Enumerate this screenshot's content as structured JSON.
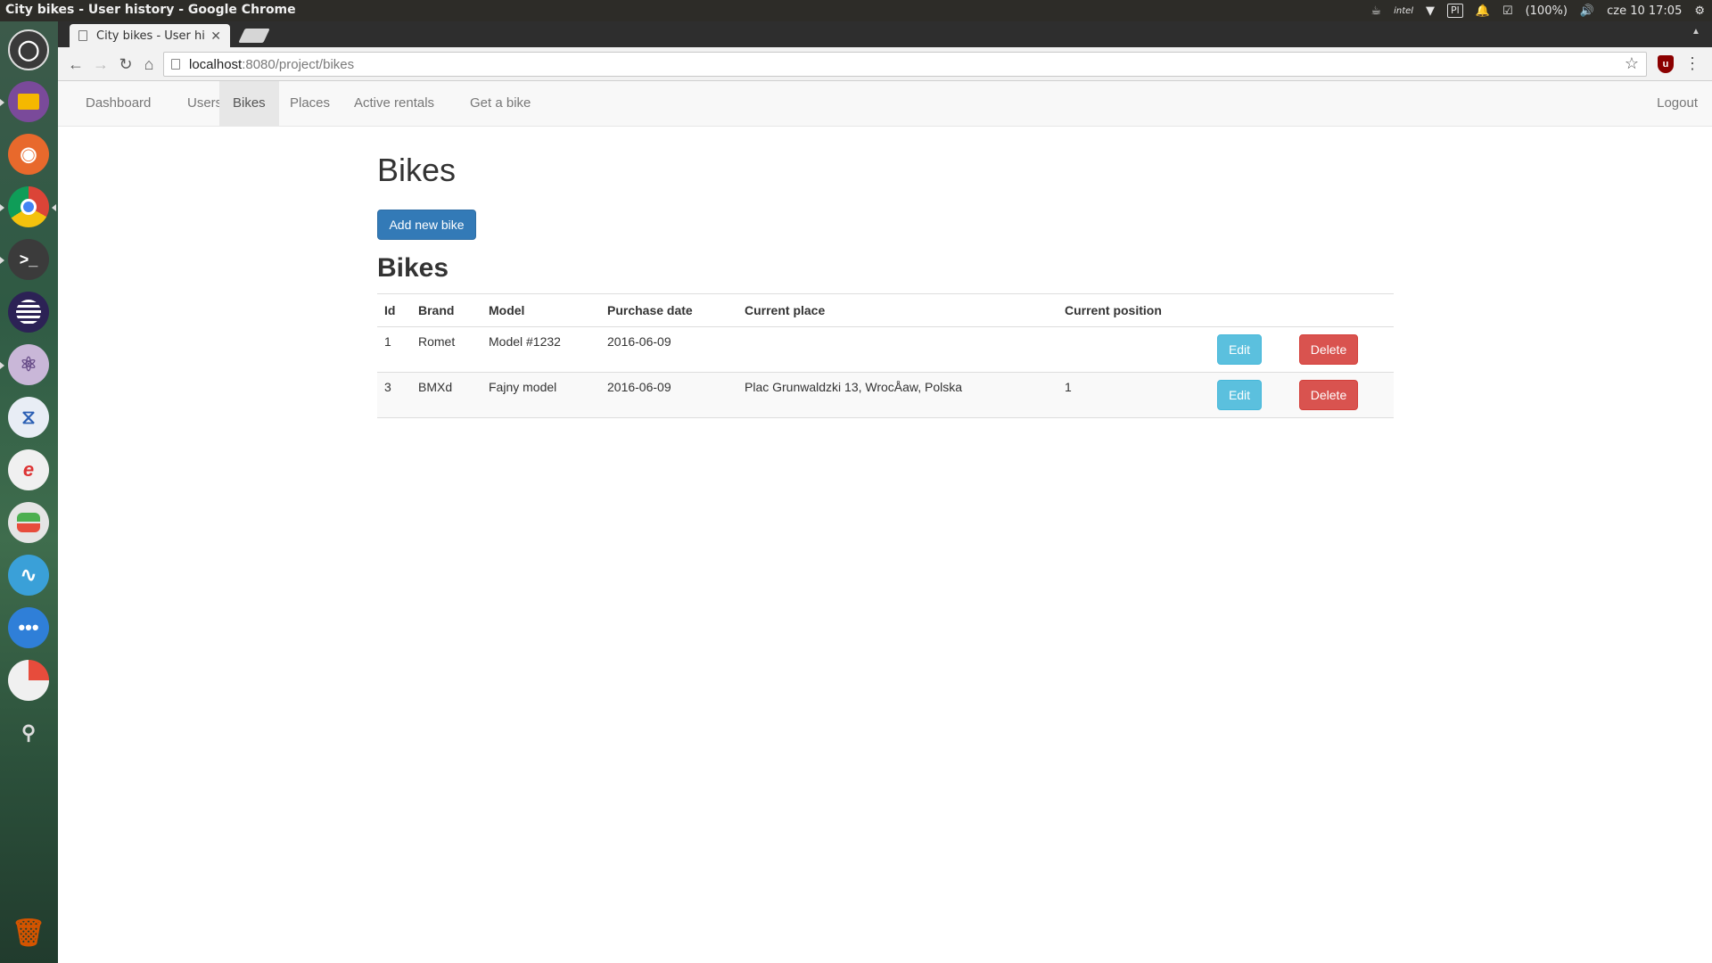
{
  "os": {
    "window_title": "City bikes - User history - Google Chrome",
    "indicators": {
      "keyboard": "Pl",
      "battery": "(100%)",
      "clock": "cze 10 17:05"
    }
  },
  "browser": {
    "tab_title": "City bikes - User his",
    "url_host": "localhost",
    "url_rest": ":8080/project/bikes"
  },
  "navbar": {
    "items": [
      {
        "label": "Dashboard"
      },
      {
        "label": "Users"
      },
      {
        "label": "Bikes",
        "active": true
      },
      {
        "label": "Places"
      },
      {
        "label": "Active rentals"
      },
      {
        "label": "Get a bike"
      }
    ],
    "logout_label": "Logout"
  },
  "page": {
    "title": "Bikes",
    "add_button": "Add new bike",
    "table_heading": "Bikes"
  },
  "table": {
    "columns": [
      "Id",
      "Brand",
      "Model",
      "Purchase date",
      "Current place",
      "Current position"
    ],
    "rows": [
      {
        "id": "1",
        "brand": "Romet",
        "model": "Model #1232",
        "purchase_date": "2016-06-09",
        "current_place": "",
        "current_position": "",
        "edit": "Edit",
        "delete": "Delete"
      },
      {
        "id": "3",
        "brand": "BMXd",
        "model": "Fajny model",
        "purchase_date": "2016-06-09",
        "current_place": "Plac Grunwaldzki 13, WrocÅaw, Polska",
        "current_position": "1",
        "edit": "Edit",
        "delete": "Delete"
      }
    ]
  },
  "colors": {
    "primary": "#337ab7",
    "info": "#5bc0de",
    "danger": "#d9534f"
  }
}
